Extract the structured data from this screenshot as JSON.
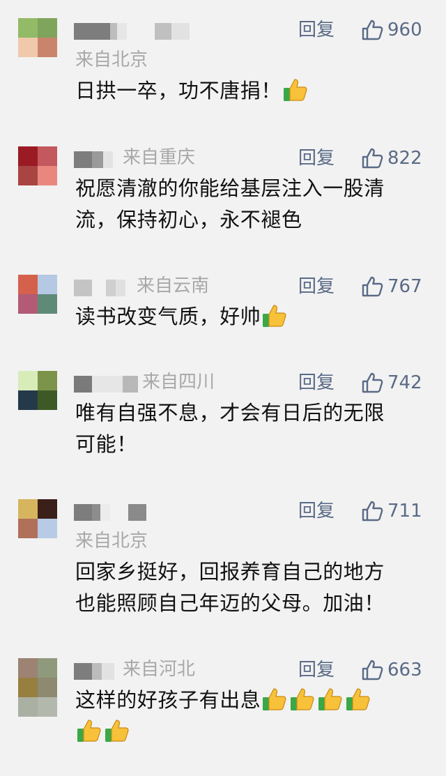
{
  "reply_label": "回复",
  "emoji_name": "thumbs-up-emoji",
  "colors": {
    "meta_text": "#5a6a86",
    "location_text": "#a8a8a8",
    "body_text": "#111111",
    "background": "#f2f2f2"
  },
  "comments": [
    {
      "location": "来自北京",
      "likes": "960",
      "lines": [
        "日拱一卒，功不唐捐！"
      ],
      "trailing_emojis": 1
    },
    {
      "location": "来自重庆",
      "likes": "822",
      "lines": [
        "祝愿清澈的你能给基层注入一股清",
        "流，保持初心，永不褪色"
      ],
      "trailing_emojis": 0
    },
    {
      "location": "来自云南",
      "likes": "767",
      "lines": [
        "读书改变气质，好帅"
      ],
      "trailing_emojis": 1
    },
    {
      "location": "来自四川",
      "likes": "742",
      "lines": [
        "唯有自强不息，才会有日后的无限",
        "可能！"
      ],
      "trailing_emojis": 0
    },
    {
      "location": "来自北京",
      "likes": "711",
      "lines": [
        "回家乡挺好，回报养育自己的地方",
        "也能照顾自己年迈的父母。加油！"
      ],
      "trailing_emojis": 0
    },
    {
      "location": "来自河北",
      "likes": "663",
      "lines": [
        "这样的好孩子有出息"
      ],
      "trailing_emojis": 6
    }
  ]
}
